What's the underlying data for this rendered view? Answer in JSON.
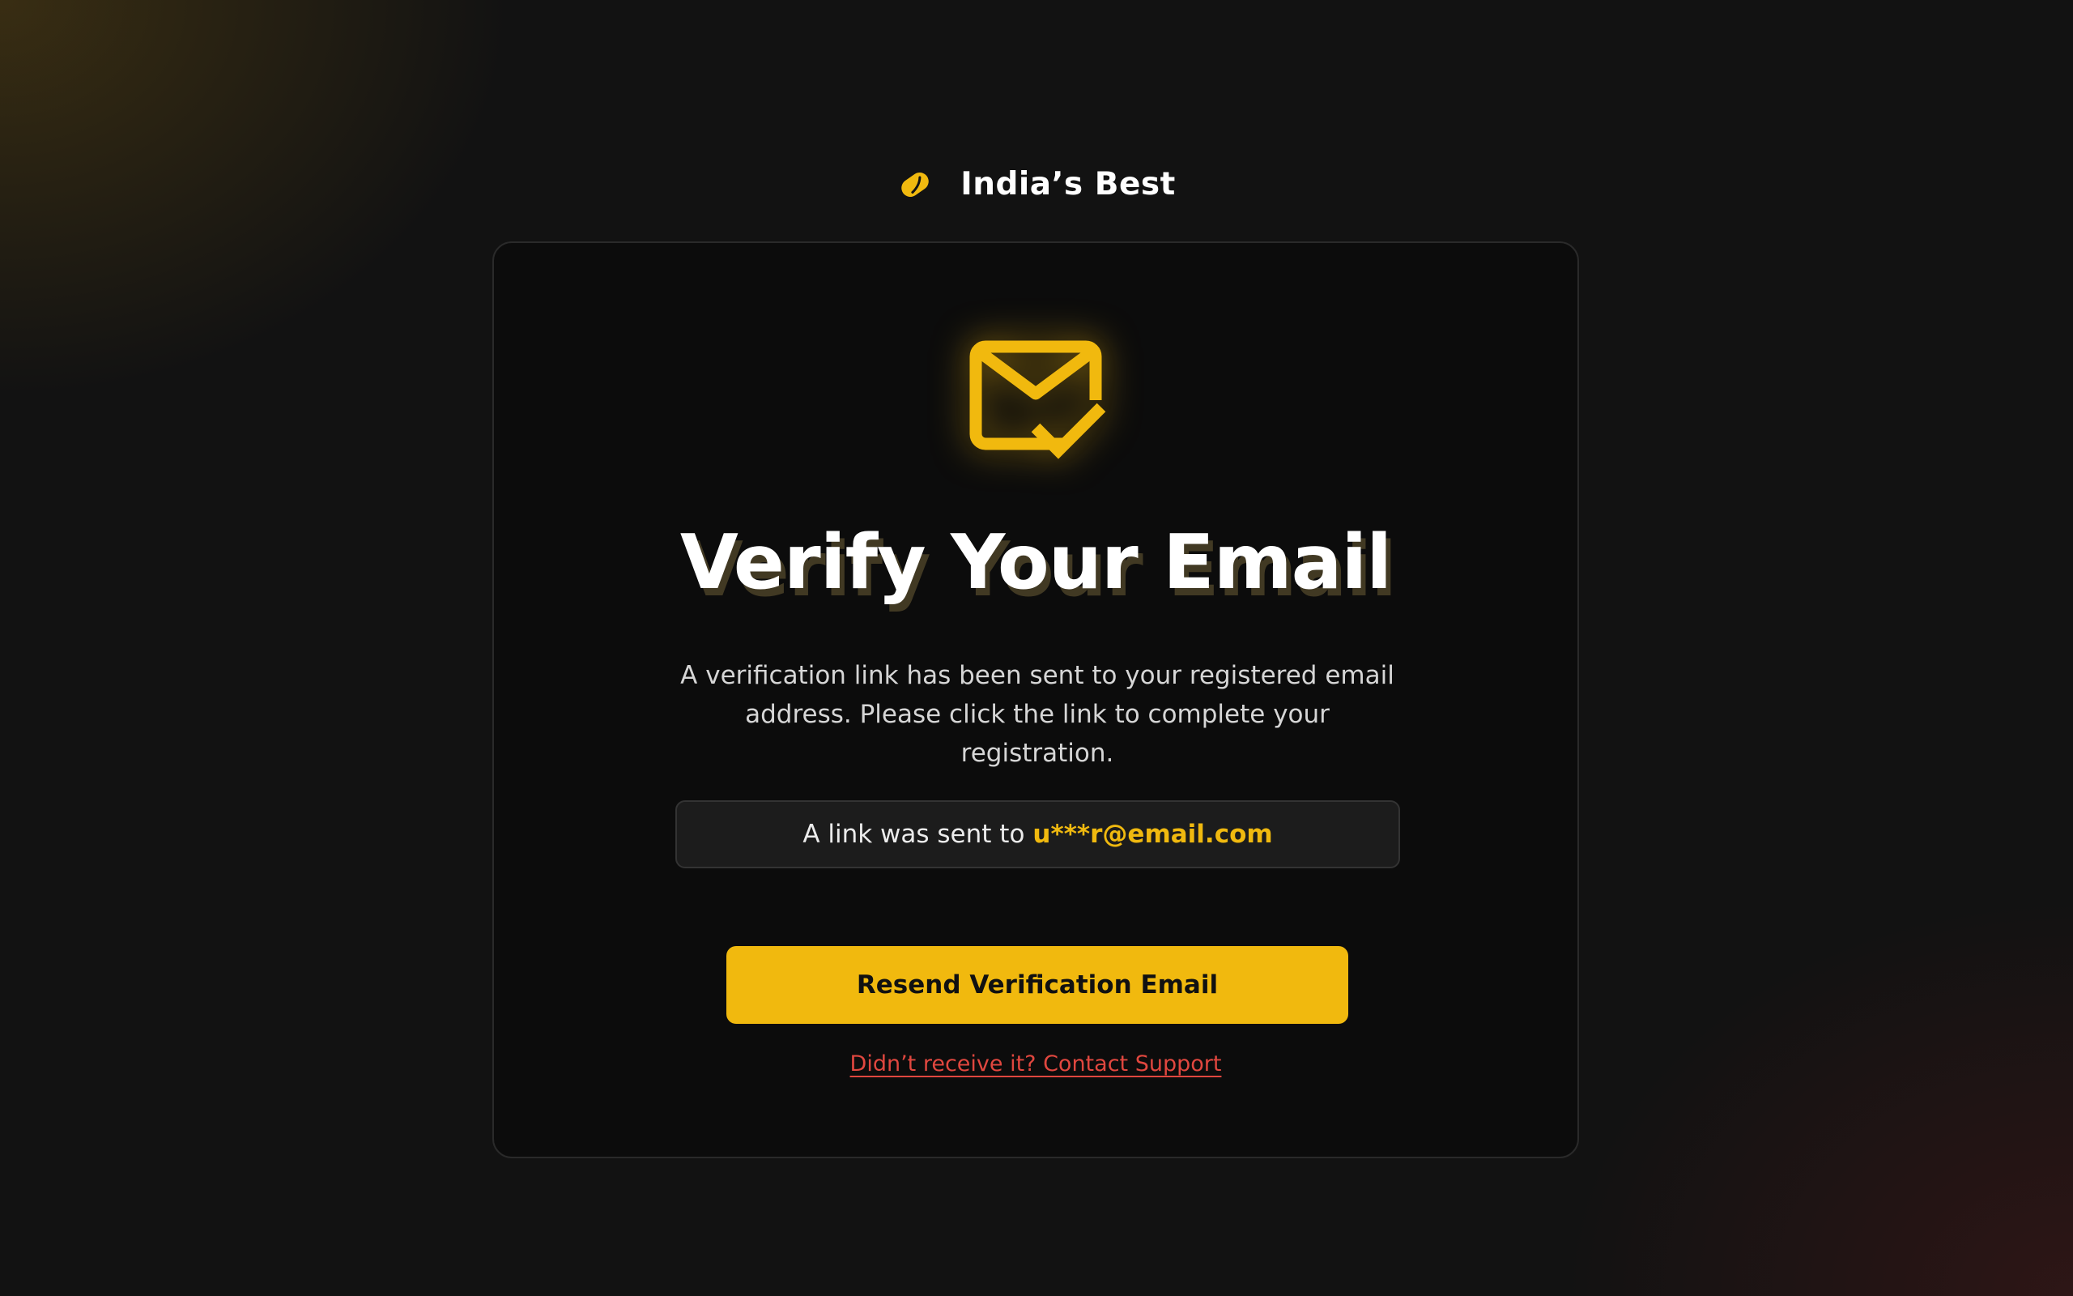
{
  "brand": {
    "name": "India’s Best",
    "logo_icon": "badge-leaf-icon",
    "accent_color": "#f0b90f"
  },
  "card": {
    "icon": "mail-check-icon",
    "title": "Verify Your Email",
    "description": "A verification link has been sent to your registered email address. Please click the link to complete your registration.",
    "sent_notice": {
      "prefix": "A link was sent to",
      "email": "u***r@email.com"
    },
    "resend_button_label": "Resend Verification Email",
    "support_link_label": "Didn’t receive it? Contact Support"
  },
  "colors": {
    "background": "#121212",
    "card_background": "#0c0c0c",
    "accent": "#f1b90e",
    "link": "#e0473f"
  }
}
